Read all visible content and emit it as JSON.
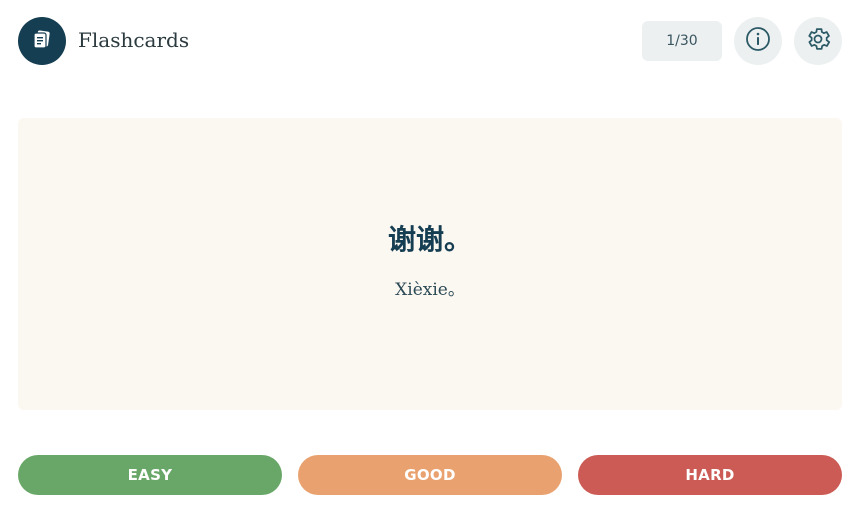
{
  "header": {
    "app_title": "Flashcards",
    "logo_icon": "flashcards-icon",
    "counter": "1/30",
    "info_icon": "info-icon",
    "settings_icon": "gear-icon"
  },
  "card": {
    "term": "谢谢。",
    "reading": "Xièxie。"
  },
  "rating_buttons": {
    "easy": "EASY",
    "good": "GOOD",
    "hard": "HARD"
  },
  "colors": {
    "brand": "#163e52",
    "card_background": "#fbf7f1",
    "easy": "#69a768",
    "good": "#e9a26f",
    "hard": "#cb5b54"
  }
}
